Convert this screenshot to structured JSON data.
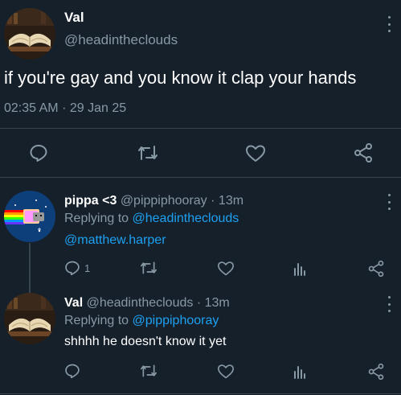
{
  "main_tweet": {
    "author_name": "Val",
    "author_handle": "@headintheclouds",
    "text": "if you're gay and you know it clap your hands",
    "time": "02:35 AM",
    "separator": "·",
    "date": "29 Jan 25"
  },
  "replies": [
    {
      "author_name": "pippa <3",
      "author_handle": "@pippiphooray",
      "age": "· 13m",
      "replying_label": "Replying to",
      "replying_to": "@headintheclouds",
      "text": "@matthew.harper",
      "reply_count": "1"
    },
    {
      "author_name": "Val",
      "author_handle": "@headintheclouds",
      "age": "· 13m",
      "replying_label": "Replying to",
      "replying_to": "@pippiphooray",
      "text": "shhhh he doesn't know it yet",
      "reply_count": ""
    }
  ],
  "icons": {
    "reply": "reply-icon",
    "retweet": "retweet-icon",
    "like": "heart-icon",
    "analytics": "analytics-icon",
    "share": "share-icon",
    "more": "more-vertical-icon"
  },
  "colors": {
    "background": "#15202b",
    "text": "#ffffff",
    "muted": "#8899a6",
    "link": "#1da1f2",
    "divider": "#38444d"
  }
}
